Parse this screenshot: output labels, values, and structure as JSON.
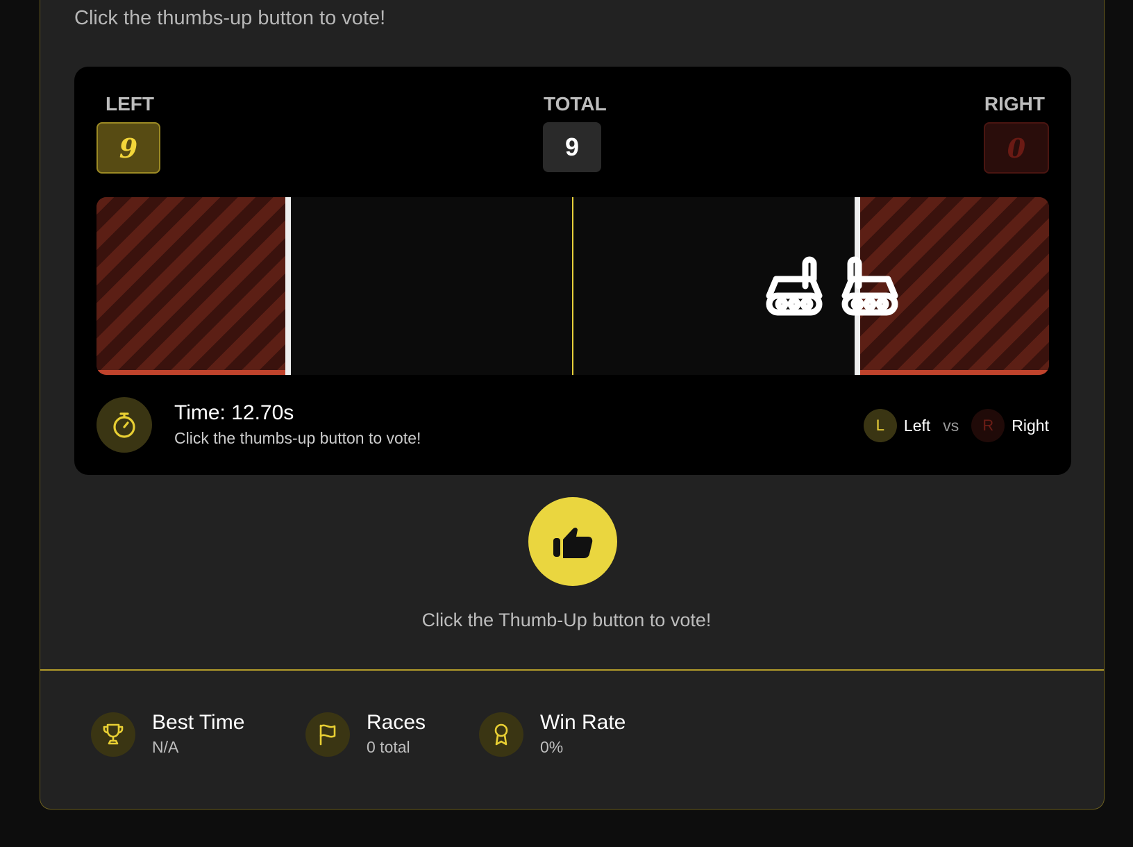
{
  "header": {
    "hint": "Click the thumbs-up button to vote!"
  },
  "scoreboard": {
    "left_label": "LEFT",
    "left_score": "9",
    "total_label": "TOTAL",
    "total_score": "9",
    "right_label": "RIGHT",
    "right_score": "0"
  },
  "race": {
    "time": "Time: 12.70s",
    "status": "Click the thumbs-up button to vote!",
    "left_badge": "L",
    "left_name": "Left",
    "vs": "vs",
    "right_badge": "R",
    "right_name": "Right"
  },
  "vote": {
    "button_icon": "thumbs-up-icon",
    "cta": "Click the Thumb-Up button to vote!"
  },
  "stats": [
    {
      "icon": "trophy-icon",
      "label": "Best Time",
      "value": "N/A"
    },
    {
      "icon": "flag-icon",
      "label": "Races",
      "value": "0 total"
    },
    {
      "icon": "award-icon",
      "label": "Win Rate",
      "value": "0%"
    }
  ],
  "colors": {
    "accent": "#ead63f",
    "danger": "#c0432c",
    "card": "#222222",
    "arena": "#000000"
  }
}
